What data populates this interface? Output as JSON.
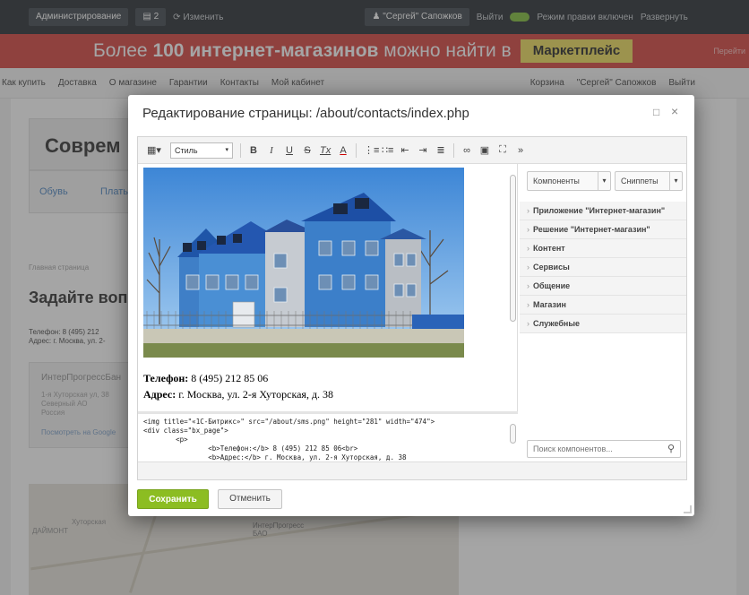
{
  "admin_bar": {
    "admin_button": "Администрирование",
    "count_button": "2",
    "edit_mode": "Изменить",
    "user_button": "\"Сергей\" Сапожков",
    "logout": "Выйти",
    "toggle_label": "Режим правки включен",
    "settings": "Развернуть"
  },
  "banner": {
    "prefix": "Более ",
    "bold": "100 интернет-магазинов",
    "suffix": " можно найти в",
    "tag": "Маркетплейс",
    "small": "Перейти"
  },
  "bg_nav": {
    "items": [
      "Как купить",
      "Доставка",
      "О магазине",
      "Гарантии",
      "Контакты",
      "Мой кабинет"
    ],
    "right": [
      "Корзина",
      "\"Сергей\" Сапожков",
      "Выйти"
    ]
  },
  "bg_page": {
    "title": "Соврем",
    "tab1": "Обувь",
    "tab2": "Плать",
    "breadcrumb": "Главная страница",
    "heading": "Задайте воп",
    "phone": "Телефон: 8 (495) 212",
    "address": "Адрес: г. Москва, ул. 2-",
    "card_title": "ИнтерПрогрессБан",
    "card_text1": "1-я Хуторская ул, 38",
    "card_text2": "Северный АО",
    "card_text3": "Россия",
    "card_link": "Посмотреть на Google",
    "map_label1": "Хуторская",
    "map_label2": "ДАЙМОНТ",
    "map_label3": "ИнтерПрогресс",
    "map_label4": "БАО"
  },
  "dialog": {
    "title": "Редактирование страницы: /about/contacts/index.php",
    "close_icon": "×",
    "expand_icon": "□"
  },
  "toolbar": {
    "style_label": "Стиль",
    "bold": "B",
    "italic": "I",
    "underline": "U",
    "strike": "S",
    "remove_format": "Tx",
    "font_color": "A",
    "more": "»"
  },
  "content": {
    "phone_label": "Телефон:",
    "phone_value": " 8 (495) 212 85 06",
    "address_label": "Адрес:",
    "address_value": " г. Москва, ул. 2-я Хуторская, д. 38"
  },
  "code": {
    "line1": "<img title=\"«1С-Битрикс»\" src=\"/about/sms.png\" height=\"281\" width=\"474\">",
    "line2": "<div class=\"bx_page\">",
    "line3": "        <p>",
    "line4": "                <b>Телефон:</b> 8 (495) 212 85 06<br>",
    "line5": "                <b>Адрес:</b> г. Москва, ул. 2-я Хуторская, д. 38"
  },
  "sidebar": {
    "components_button": "Компоненты",
    "snippets_button": "Сниппеты",
    "items": [
      "Приложение \"Интернет-магазин\"",
      "Решение \"Интернет-магазин\"",
      "Контент",
      "Сервисы",
      "Общение",
      "Магазин",
      "Служебные"
    ],
    "search_placeholder": "Поиск компонентов..."
  },
  "buttons": {
    "save": "Сохранить",
    "cancel": "Отменить"
  },
  "colors": {
    "save_green": "#8cbd22",
    "banner_red": "#d9534f",
    "market_yellow": "#f0e06a",
    "building_blue": "#2f6db5"
  }
}
